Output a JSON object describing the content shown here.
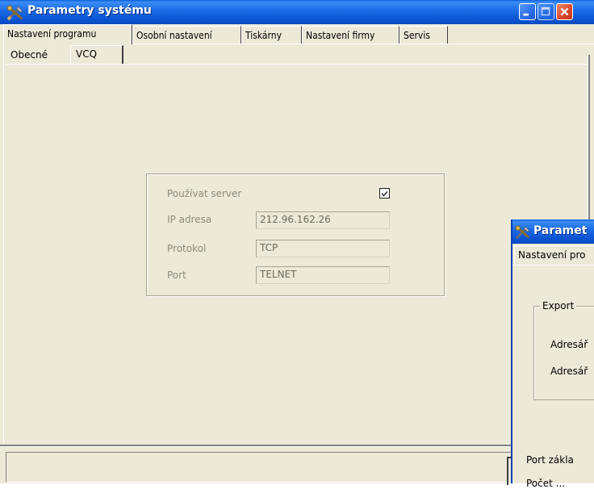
{
  "window": {
    "title": "Parametry systému",
    "icon": "tools-icon",
    "controls": [
      "minimize-icon",
      "maximize-icon",
      "close-icon"
    ]
  },
  "main_tabs": [
    {
      "label": "Nastavení programu"
    },
    {
      "label": "Osobní nastavení"
    },
    {
      "label": "Tiskárny"
    },
    {
      "label": "Nastavení firmy"
    },
    {
      "label": "Servis"
    }
  ],
  "sub_tabs": [
    {
      "label": "Obecné"
    },
    {
      "label": "VCQ"
    }
  ],
  "vcq": {
    "use_server_label": "Používat server",
    "use_server_checked": true,
    "ip_label": "IP adresa",
    "ip_value": "212.96.162.26",
    "protocol_label": "Protokol",
    "protocol_value": "TCP",
    "port_label": "Port",
    "port_value": "TELNET"
  },
  "second_window": {
    "title": "Paramet",
    "tab_label": "Nastavení pro",
    "group_title": "Export",
    "row1": "Adresář",
    "row2": "Adresář",
    "row3": "Port zákla",
    "row4": "Počet ..."
  },
  "colors": {
    "titlebar": "#0c56d4",
    "face": "#ece9d8",
    "disabled_text": "#8c8a7f"
  }
}
